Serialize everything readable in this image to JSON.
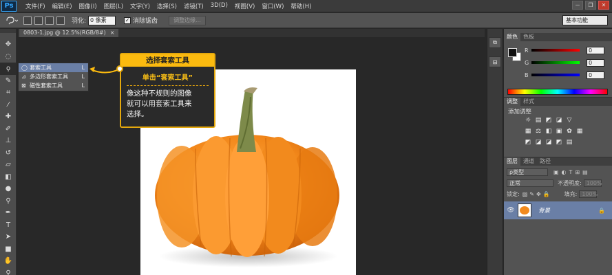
{
  "app": {
    "logo": "Ps"
  },
  "menu": [
    "文件(F)",
    "编辑(E)",
    "图像(I)",
    "图层(L)",
    "文字(Y)",
    "选择(S)",
    "滤镜(T)",
    "3D(D)",
    "视图(V)",
    "窗口(W)",
    "帮助(H)"
  ],
  "window_controls": [
    "－",
    "❐",
    "✕"
  ],
  "options": {
    "feather_label": "羽化:",
    "feather_value": "0 像素",
    "antialias_check": "✓",
    "antialias_label": "消除锯齿",
    "refine_edge": "调整边缘...",
    "workspace": "基本功能"
  },
  "document_tab": {
    "title": "0803-1.jpg @ 12.5%(RGB/8#)",
    "close": "×"
  },
  "flyout": [
    {
      "icon": "◯",
      "label": "套索工具",
      "key": "L"
    },
    {
      "icon": "⊿",
      "label": "多边形套索工具",
      "key": "L"
    },
    {
      "icon": "⊠",
      "label": "磁性套索工具",
      "key": "L"
    }
  ],
  "callout": {
    "title": "选择套索工具",
    "subtitle": "单击“套索工具”",
    "body": [
      "像这种不规则的图像",
      "就可以用套索工具来",
      "选择。"
    ]
  },
  "color_panel": {
    "tabs": [
      "颜色",
      "色板"
    ],
    "channels": [
      {
        "label": "R",
        "value": "0",
        "track": "#a33"
      },
      {
        "label": "G",
        "value": "0",
        "track": "#2a2"
      },
      {
        "label": "B",
        "value": "0",
        "track": "#33a"
      }
    ]
  },
  "adjust_panel": {
    "tabs": [
      "调整",
      "样式"
    ],
    "add_label": "添加调整",
    "icons": [
      [
        "☼",
        "▤",
        "◩",
        "◪",
        "▽"
      ],
      [
        "▦",
        "⚖",
        "◧",
        "▣",
        "✿",
        "▦"
      ],
      [
        "◩",
        "◪",
        "◪",
        "◩",
        "▤"
      ]
    ]
  },
  "layers_panel": {
    "tabs": [
      "图层",
      "通道",
      "路径"
    ],
    "kind": "ρ类型",
    "blend": "正常",
    "opacity_label": "不透明度:",
    "opacity_value": "100%",
    "lock_label": "锁定:",
    "fill_label": "填充:",
    "fill_value": "100%",
    "layer_name": "背景"
  },
  "colors": {
    "callout_accent": "#fbba0f",
    "selection": "#6a7fa6",
    "pumpkin": "#f28a1e"
  }
}
